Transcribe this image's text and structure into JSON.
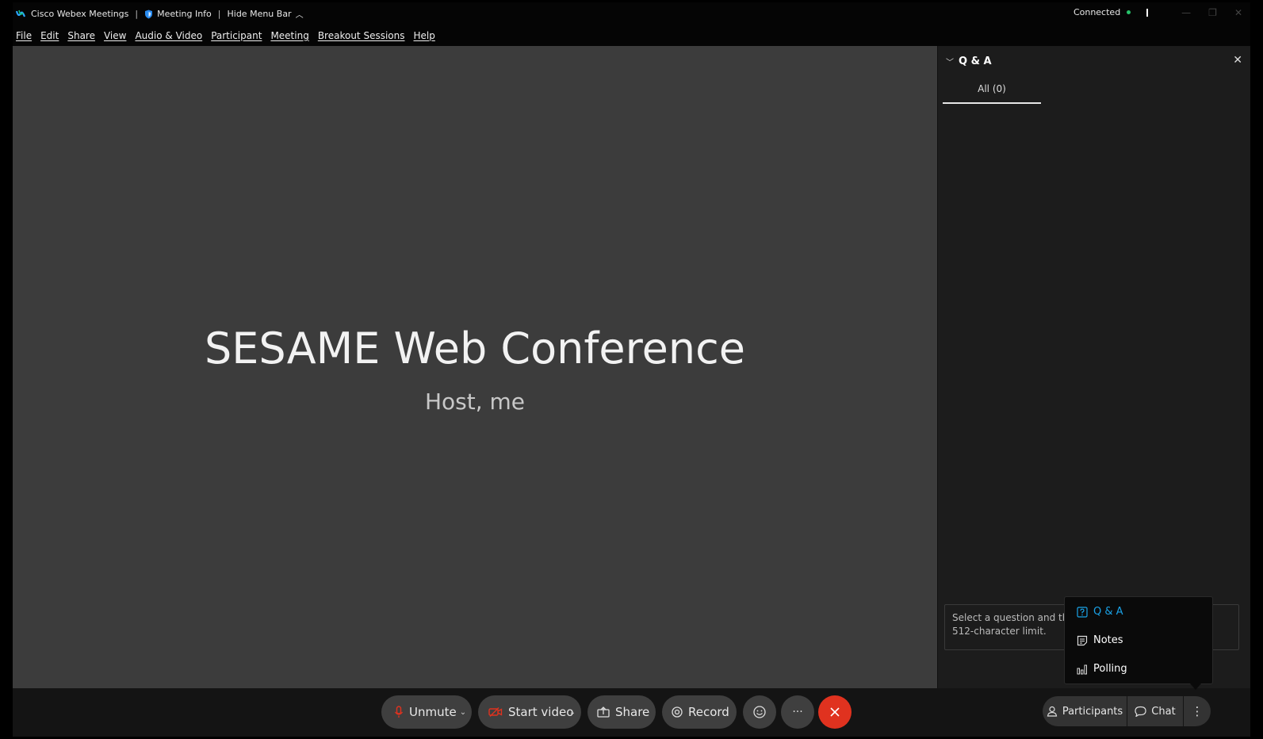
{
  "titlebar": {
    "app_name": "Cisco Webex Meetings",
    "meeting_info": "Meeting Info",
    "hide_menu": "Hide Menu Bar",
    "status": "Connected"
  },
  "menubar": {
    "items": [
      "File",
      "Edit",
      "Share",
      "View",
      "Audio & Video",
      "Participant",
      "Meeting",
      "Breakout Sessions",
      "Help"
    ]
  },
  "stage": {
    "title": "SESAME Web Conference",
    "subtitle": "Host, me"
  },
  "panel": {
    "title": "Q & A",
    "tab_all": "All (0)",
    "input_placeholder_line1": "Select a question and then typ",
    "input_placeholder_line2": "512-character limit."
  },
  "bottombar": {
    "unmute": "Unmute",
    "start_video": "Start video",
    "share": "Share",
    "record": "Record",
    "more": "···",
    "participants": "Participants",
    "chat": "Chat"
  },
  "popup": {
    "items": [
      "Q & A",
      "Notes",
      "Polling"
    ]
  },
  "colors": {
    "accent": "#1aa3e8",
    "end_call": "#e0321f",
    "status_ok": "#27c26a",
    "mute_red": "#e0321f"
  }
}
